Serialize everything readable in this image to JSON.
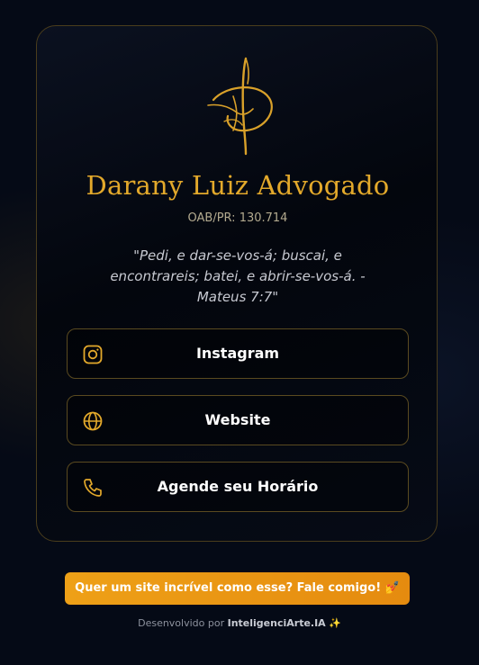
{
  "profile": {
    "name": "Darany Luiz Advogado",
    "oab": "OAB/PR: 130.714",
    "quote": "\"Pedi, e dar-se-vos-á; buscai, e encontrareis; batei, e abrir-se-vos-á. - Mateus 7:7\""
  },
  "links": [
    {
      "label": "Instagram",
      "icon": "instagram-icon"
    },
    {
      "label": "Website",
      "icon": "globe-icon"
    },
    {
      "label": "Agende seu Horário",
      "icon": "phone-icon"
    }
  ],
  "cta": {
    "label": "Quer um site incrível como esse? Fale comigo! 💅"
  },
  "footer": {
    "prefix": "Desenvolvido por",
    "brand": "InteligenciArte.IA",
    "emoji": "✨"
  },
  "colors": {
    "accent": "#e3a92b",
    "background": "#050a16",
    "cta": "#eea017"
  }
}
